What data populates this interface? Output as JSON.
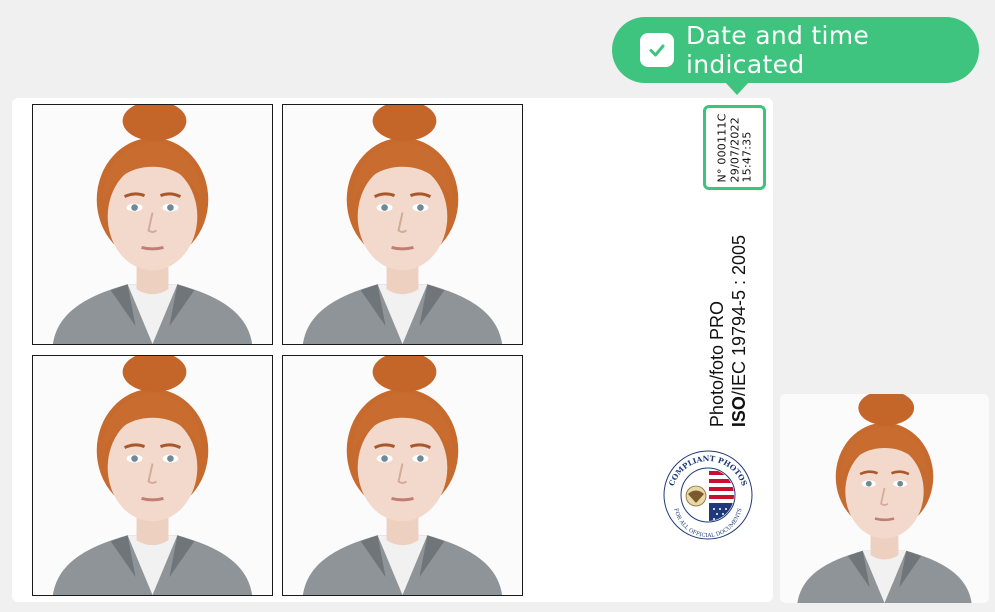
{
  "tooltip": {
    "label": "Date and time indicated",
    "icon": "check-icon",
    "color": "#3ec47e"
  },
  "stamp": {
    "number": "N° 000111C",
    "date": "29/07/2022",
    "time": "15:47:35",
    "border_color": "#3cc47c"
  },
  "brand": {
    "name": "Photo/foto PRO",
    "standard_bold": "ISO",
    "standard_rest": "/IEC 19794-5 : 2005"
  },
  "seal": {
    "top_text": "COMPLIANT PHOTOS",
    "bottom_text": "FOR ALL OFFICIAL DOCUMENTS"
  },
  "photos": [
    {
      "alt": "passport-photo"
    },
    {
      "alt": "passport-photo"
    },
    {
      "alt": "passport-photo"
    },
    {
      "alt": "passport-photo"
    }
  ],
  "single_photo": {
    "alt": "passport-photo"
  }
}
